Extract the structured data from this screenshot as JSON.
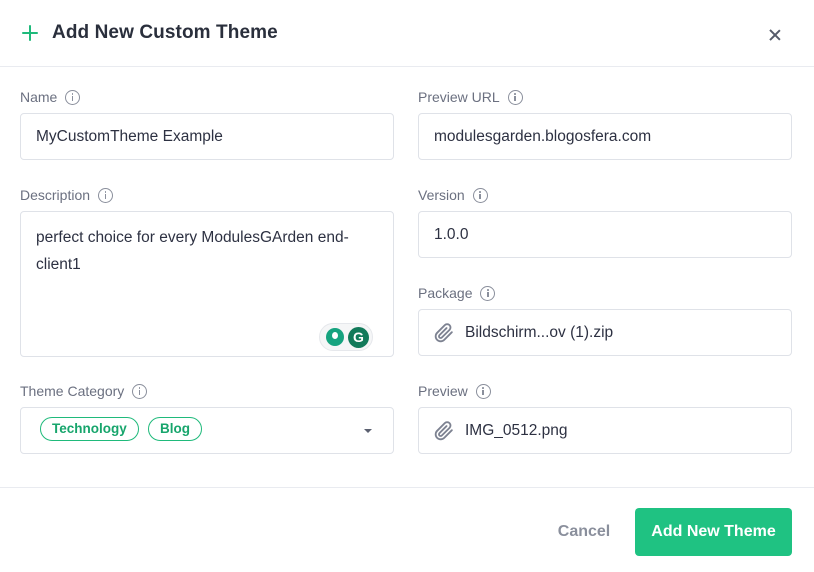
{
  "dialog": {
    "title": "Add New Custom Theme"
  },
  "form": {
    "name": {
      "label": "Name",
      "value": "MyCustomTheme Example"
    },
    "preview_url": {
      "label": "Preview URL",
      "value": "modulesgarden.blogosfera.com"
    },
    "description": {
      "label": "Description",
      "value": "perfect choice for every ModulesGArden end-client1"
    },
    "version": {
      "label": "Version",
      "value": "1.0.0"
    },
    "package": {
      "label": "Package",
      "value": "Bildschirm...ov (1).zip",
      "icon": "paperclip-icon"
    },
    "theme_category": {
      "label": "Theme Category",
      "tags": [
        "Technology",
        "Blog"
      ]
    },
    "preview": {
      "label": "Preview",
      "value": "IMG_0512.png",
      "icon": "paperclip-icon"
    }
  },
  "footer": {
    "cancel_label": "Cancel",
    "submit_label": "Add New Theme"
  },
  "colors": {
    "accent": "#1fc282",
    "tag_border": "#1fba7b",
    "text": "#2d3142",
    "muted": "#6b7080"
  }
}
